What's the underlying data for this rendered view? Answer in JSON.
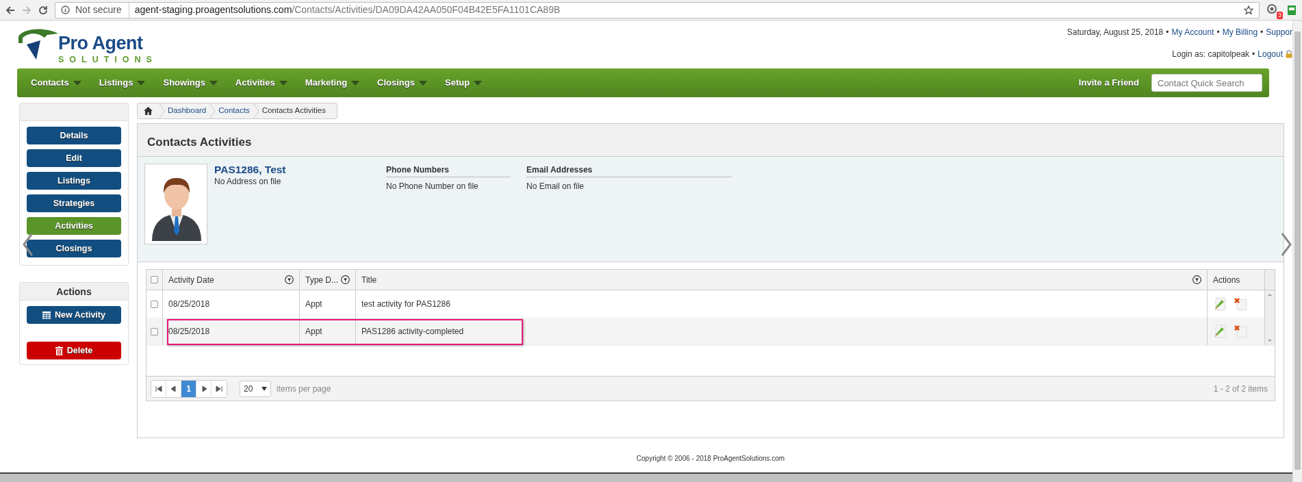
{
  "browser": {
    "security": "Not secure",
    "host": "agent-staging.proagentsolutions.com",
    "path": "/Contacts/Activities/DA09DA42AA050F04B42E5FA1101CA89B",
    "extension_badge": "3"
  },
  "logo": {
    "name": "Pro Agent",
    "tagline": "SOLUTIONS"
  },
  "header": {
    "line1": [
      {
        "kind": "text",
        "text": "Saturday, August 25, 2018"
      },
      {
        "kind": "separator",
        "text": "•"
      },
      {
        "kind": "link",
        "text": "My Account"
      },
      {
        "kind": "separator",
        "text": "•"
      },
      {
        "kind": "link",
        "text": "My Billing"
      },
      {
        "kind": "separator",
        "text": "•"
      },
      {
        "kind": "link",
        "text": "Suppor"
      }
    ],
    "line2": [
      {
        "kind": "text",
        "text": "Login as: capitolpeak"
      },
      {
        "kind": "separator",
        "text": "•"
      },
      {
        "kind": "link",
        "text": "Logout"
      }
    ]
  },
  "menu": [
    {
      "label": "Contacts"
    },
    {
      "label": "Listings"
    },
    {
      "label": "Showings"
    },
    {
      "label": "Activities"
    },
    {
      "label": "Marketing"
    },
    {
      "label": "Closings"
    },
    {
      "label": "Setup"
    }
  ],
  "invite": "Invite a Friend",
  "quick_search": {
    "placeholder": "Contact Quick Search"
  },
  "sidebar": {
    "items": [
      {
        "label": "Details",
        "selected": false
      },
      {
        "label": "Edit",
        "selected": false
      },
      {
        "label": "Listings",
        "selected": false
      },
      {
        "label": "Strategies",
        "selected": false
      },
      {
        "label": "Activities",
        "selected": true
      },
      {
        "label": "Closings",
        "selected": false
      }
    ]
  },
  "actions": {
    "title": "Actions",
    "buttons": [
      {
        "label": "New Activity",
        "kind": "new"
      },
      {
        "label": "Delete",
        "kind": "delete"
      }
    ]
  },
  "breadcrumb": [
    "Dashboard",
    "Contacts",
    "Contacts Activities"
  ],
  "panel_title": "Contacts Activities",
  "contact": {
    "name": "PAS1286, Test",
    "address": "No Address on file",
    "phone_title": "Phone Numbers",
    "phone": "No Phone Number on file",
    "email_title": "Email Addresses",
    "email": "No Email on file"
  },
  "grid": {
    "select_all_checked": false,
    "columns": [
      {
        "label": "Activity Date",
        "filter": true
      },
      {
        "label": "Type D...",
        "filter": true
      },
      {
        "label": "Title",
        "filter": true
      },
      {
        "label": "Actions",
        "filter": false
      }
    ],
    "rows": [
      {
        "checked": false,
        "annotated": false,
        "cells": [
          "08/25/2018",
          "Appt",
          "test activity for PAS1286"
        ]
      },
      {
        "checked": false,
        "annotated": true,
        "cells": [
          "08/25/2018",
          "Appt",
          "PAS1286 activity-completed"
        ]
      }
    ],
    "pager": {
      "current": "1",
      "page_size": "20",
      "page_size_label": "items per page",
      "summary": "1 - 2 of 2 items"
    }
  },
  "footer": "Copyright © 2006 - 2018 ProAgentSolutions.com"
}
